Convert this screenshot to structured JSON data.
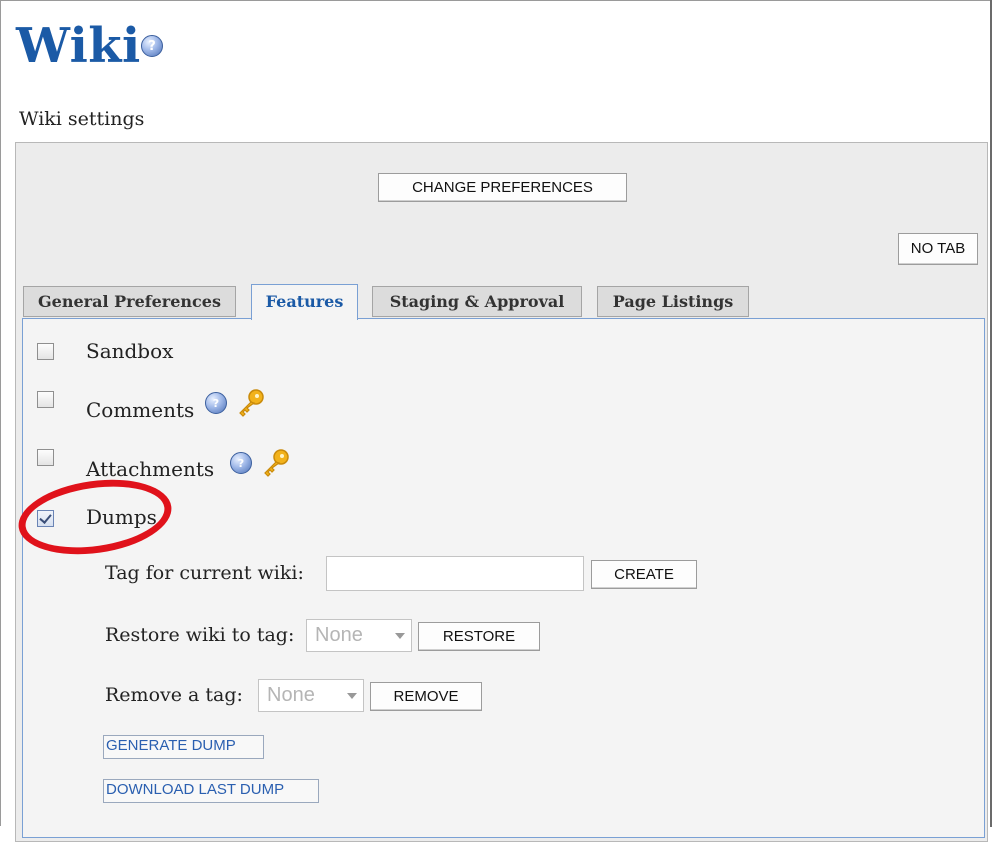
{
  "header": {
    "title": "Wiki",
    "help_icon": "help-icon",
    "settings_label": "Wiki settings"
  },
  "toolbar": {
    "change_preferences_label": "CHANGE PREFERENCES",
    "no_tab_label": "NO TAB"
  },
  "tabs": [
    {
      "label": "General Preferences",
      "active": false
    },
    {
      "label": "Features",
      "active": true
    },
    {
      "label": "Staging & Approval",
      "active": false
    },
    {
      "label": "Page Listings",
      "active": false
    }
  ],
  "features": [
    {
      "label": "Sandbox",
      "checked": false
    },
    {
      "label": "Comments",
      "checked": false,
      "icons": [
        "help-icon",
        "key-icon"
      ]
    },
    {
      "label": "Attachments",
      "checked": false,
      "icons": [
        "help-icon",
        "key-icon"
      ]
    },
    {
      "label": "Dumps",
      "checked": true,
      "highlighted": true
    }
  ],
  "dumps": {
    "tag_label": "Tag for current wiki:",
    "tag_value": "",
    "create_label": "CREATE",
    "restore_label": "Restore wiki to tag:",
    "restore_selected": "None",
    "restore_button": "RESTORE",
    "remove_label": "Remove a tag:",
    "remove_selected": "None",
    "remove_button": "REMOVE",
    "generate_label": "GENERATE DUMP",
    "download_label": "DOWNLOAD LAST DUMP"
  },
  "colors": {
    "title": "#1b5aa6",
    "active_tab_text": "#1b5aa6",
    "highlight_ring": "#e0121b",
    "link_text": "#2a5fb0"
  }
}
